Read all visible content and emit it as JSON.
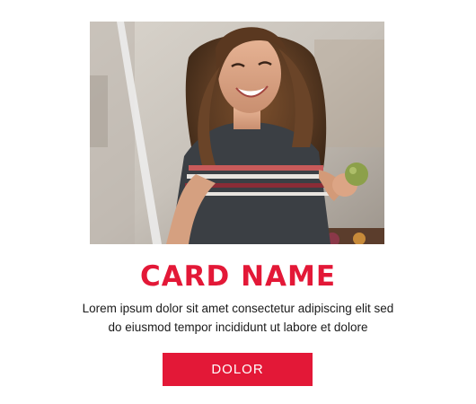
{
  "card": {
    "title": "CARD NAME",
    "description": "Lorem ipsum dolor sit amet consectetur adipiscing elit sed do eiusmod tempor incididunt ut labore et dolore",
    "button_label": "DOLOR",
    "image_icon": "photo-of-smiling-woman-holding-apple"
  },
  "colors": {
    "accent": "#e31837",
    "text": "#1a1a1a",
    "button_text": "#ffffff",
    "background": "#ffffff"
  }
}
